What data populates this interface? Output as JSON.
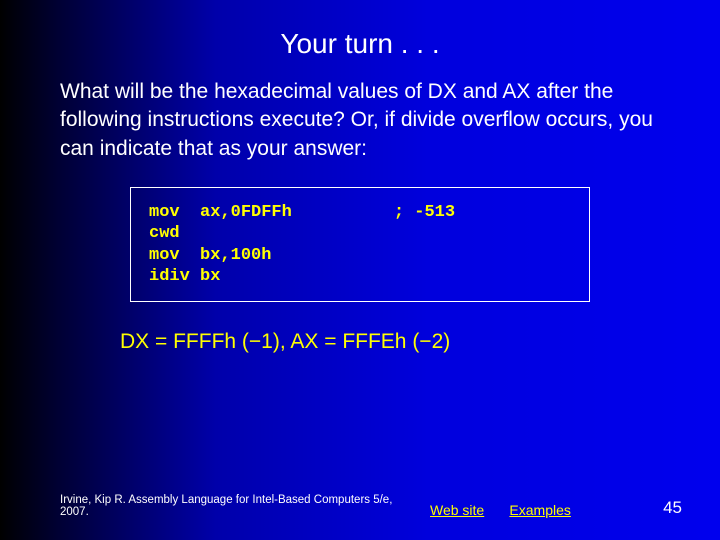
{
  "title": "Your turn . . .",
  "question": "What will be the hexadecimal values of DX and AX after the following instructions execute? Or, if divide overflow occurs, you can indicate that as your answer:",
  "code": "mov  ax,0FDFFh          ; -513\ncwd\nmov  bx,100h\nidiv bx",
  "answer": "DX = FFFFh (−1),  AX = FFFEh (−2)",
  "footer": {
    "citation": "Irvine, Kip R. Assembly Language for Intel-Based Computers 5/e, 2007.",
    "links": {
      "website": "Web site",
      "examples": "Examples"
    },
    "page_number": "45"
  }
}
